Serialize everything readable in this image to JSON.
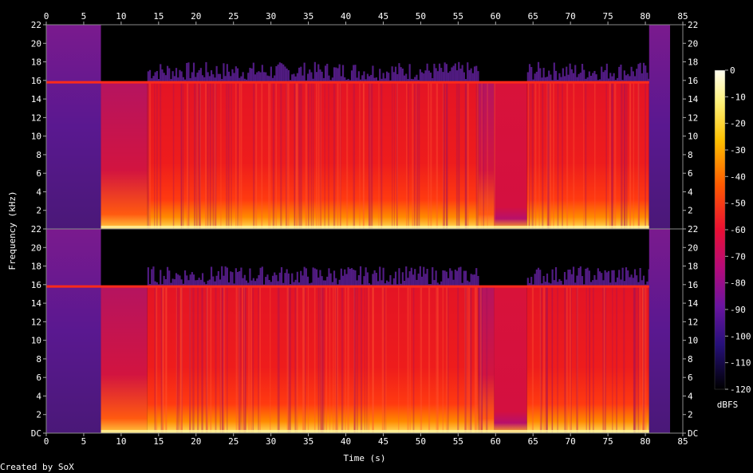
{
  "chart_data": {
    "type": "heatmap",
    "title": "",
    "xlabel": "Time (s)",
    "ylabel": "Frequency (kHz)",
    "colorbar_label": "dBFS",
    "footer": "Created by SoX",
    "xlim": [
      0,
      85
    ],
    "ylim_khz": [
      0,
      22
    ],
    "x_ticks": [
      0,
      5,
      10,
      15,
      20,
      25,
      30,
      35,
      40,
      45,
      50,
      55,
      60,
      65,
      70,
      75,
      80,
      85
    ],
    "y_ticks_top": [
      "2",
      "4",
      "6",
      "8",
      "10",
      "12",
      "14",
      "16",
      "18",
      "20",
      "22"
    ],
    "y_ticks_bottom": [
      "DC",
      "2",
      "4",
      "6",
      "8",
      "10",
      "12",
      "14",
      "16",
      "18",
      "20",
      "22"
    ],
    "colorbar_ticks": [
      0,
      -10,
      -20,
      -30,
      -40,
      -50,
      -60,
      -70,
      -80,
      -90,
      -100,
      -110,
      -120
    ],
    "colorbar_range": [
      -120,
      0
    ],
    "channels": 2,
    "lowpass_cutoff_khz": 15.8,
    "segments": [
      {
        "t0": 0.0,
        "t1": 7.3,
        "kind": "noise"
      },
      {
        "t0": 7.3,
        "t1": 13.5,
        "kind": "quiet-music"
      },
      {
        "t0": 13.5,
        "t1": 57.7,
        "kind": "music"
      },
      {
        "t0": 57.7,
        "t1": 59.8,
        "kind": "quiet-music"
      },
      {
        "t0": 59.8,
        "t1": 64.2,
        "kind": "break"
      },
      {
        "t0": 64.2,
        "t1": 80.5,
        "kind": "music"
      },
      {
        "t0": 80.5,
        "t1": 83.3,
        "kind": "noise"
      }
    ]
  }
}
